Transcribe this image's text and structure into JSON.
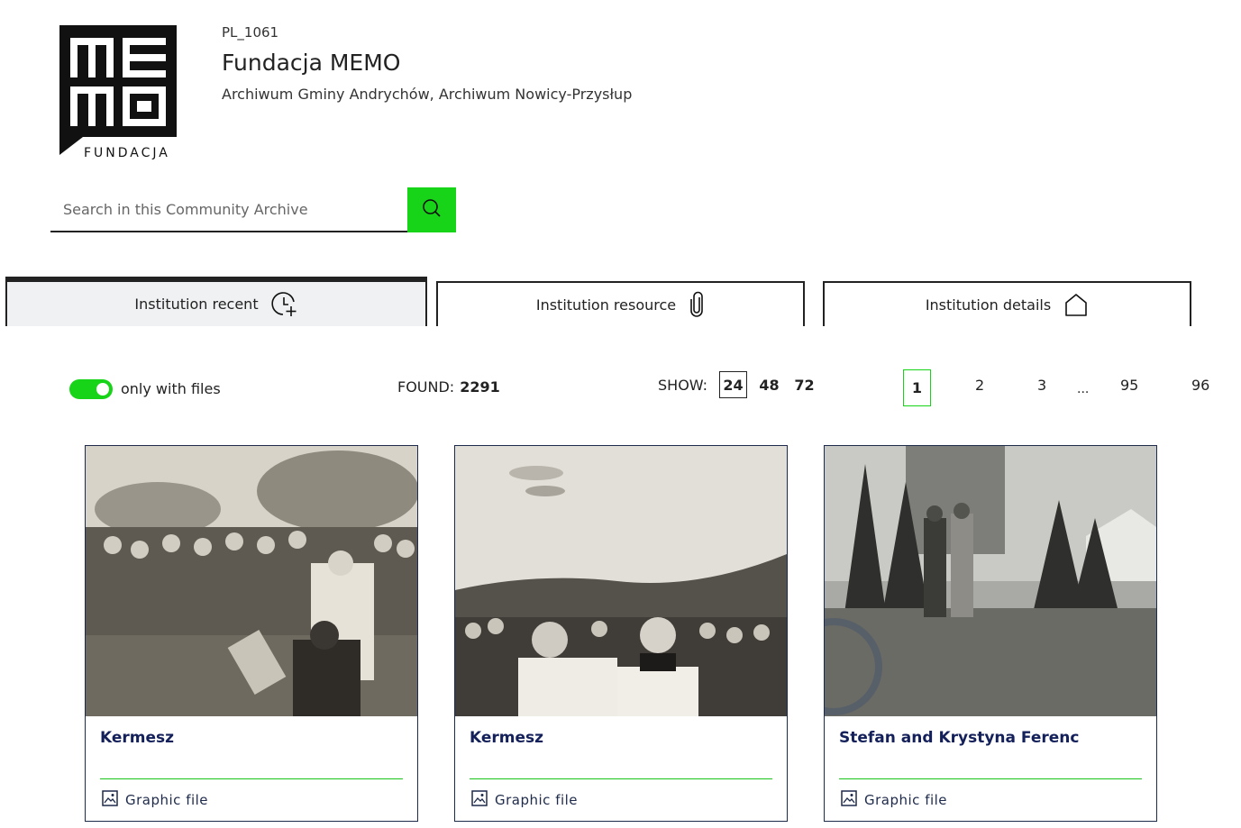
{
  "header": {
    "logo_text": "MEMO FUNDACJA",
    "logo_caption": "FUNDACJA",
    "code": "PL_1061",
    "name": "Fundacja MEMO",
    "subtitle": "Archiwum Gminy Andrychów, Archiwum Nowicy-Przysłup"
  },
  "search": {
    "placeholder": "Search in this Community Archive",
    "button_icon": "search-icon",
    "accent": "#18d418"
  },
  "tabs": [
    {
      "label": "Institution recent",
      "icon": "clock-plus-icon",
      "active": true
    },
    {
      "label": "Institution resource",
      "icon": "paperclip-icon",
      "active": false
    },
    {
      "label": "Institution details",
      "icon": "house-icon",
      "active": false
    }
  ],
  "toolbar": {
    "toggle_label": "only with files",
    "toggle_on": true,
    "found_label": "FOUND:",
    "found_count": "2291",
    "show_label": "SHOW:",
    "per_page": [
      "24",
      "48",
      "72"
    ],
    "per_page_selected": "24"
  },
  "pagination": {
    "pages": [
      "1",
      "2",
      "3",
      "95",
      "96"
    ],
    "ellipsis": "...",
    "current": "1"
  },
  "cards": [
    {
      "title": "Kermesz",
      "type": "Graphic file",
      "type_icon": "image-icon"
    },
    {
      "title": "Kermesz",
      "type": "Graphic file",
      "type_icon": "image-icon"
    },
    {
      "title": "Stefan and Krystyna Ferenc",
      "type": "Graphic file",
      "type_icon": "image-icon"
    }
  ]
}
